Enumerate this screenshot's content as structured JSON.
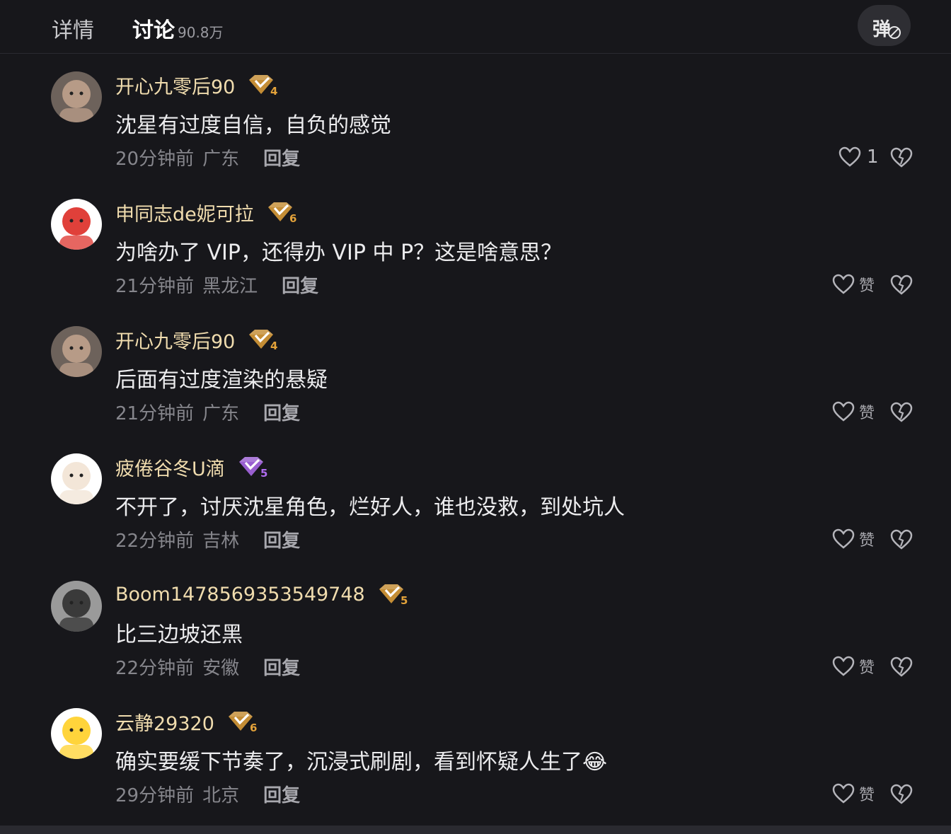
{
  "tabs": {
    "details": "详情",
    "discuss": "讨论",
    "discuss_count": "90.8万",
    "danmu_label": "弹"
  },
  "reply_label": "回复",
  "like_label": "赞",
  "colors": {
    "background": "#17171b",
    "username": "#f0dcae",
    "badge_gold": "#e3a23a",
    "badge_purple": "#b06cf0"
  },
  "comments": [
    {
      "username": "开心九零后90",
      "level": "4",
      "badge_color": "#e3a23a",
      "text": "沈星有过度自信，自负的感觉",
      "time": "20分钟前",
      "location": "广东",
      "likes": "1"
    },
    {
      "username": "申同志de妮可拉",
      "level": "6",
      "badge_color": "#e3a23a",
      "text": "为啥办了 VIP，还得办 VIP 中 P？这是啥意思？",
      "time": "21分钟前",
      "location": "黑龙江",
      "likes": ""
    },
    {
      "username": "开心九零后90",
      "level": "4",
      "badge_color": "#e3a23a",
      "text": "后面有过度渲染的悬疑",
      "time": "21分钟前",
      "location": "广东",
      "likes": ""
    },
    {
      "username": "疲倦谷冬U滴",
      "level": "5",
      "badge_color": "#b06cf0",
      "text": "不开了，讨厌沈星角色，烂好人，谁也没救，到处坑人",
      "time": "22分钟前",
      "location": "吉林",
      "likes": ""
    },
    {
      "username": "Boom1478569353549748",
      "level": "5",
      "badge_color": "#e3a23a",
      "text": "比三边坡还黑",
      "time": "22分钟前",
      "location": "安徽",
      "likes": ""
    },
    {
      "username": "云静29320",
      "level": "6",
      "badge_color": "#e3a23a",
      "text": "确实要缓下节奏了，沉浸式刷剧，看到怀疑人生了",
      "emoji": "😂",
      "time": "29分钟前",
      "location": "北京",
      "likes": ""
    }
  ]
}
